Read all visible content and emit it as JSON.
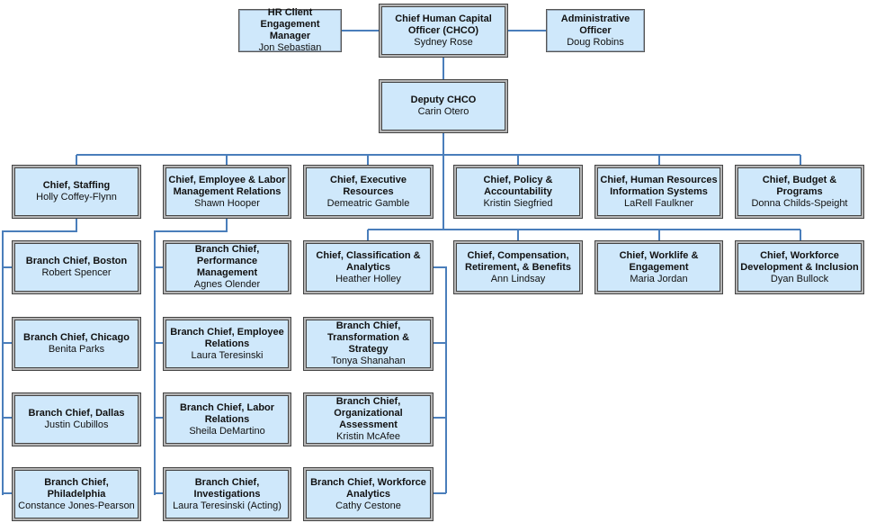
{
  "colors": {
    "box_fill": "#cfe8fb",
    "connector": "#4a7ebb",
    "border": "#444444"
  },
  "top": {
    "hr": {
      "title": "HR Client\nEngagement Manager",
      "name": "Jon Sebastian"
    },
    "chco": {
      "title": "Chief  Human Capital\nOfficer (CHCO)",
      "name": "Sydney Rose"
    },
    "admin": {
      "title": "Administrative\nOfficer",
      "name": "Doug Robins"
    },
    "deputy": {
      "title": "Deputy CHCO",
      "name": "Carin Otero"
    }
  },
  "chiefs": [
    {
      "title": "Chief, Staffing",
      "name": "Holly Coffey-Flynn"
    },
    {
      "title": "Chief, Employee & Labor\nManagement Relations",
      "name": "Shawn Hooper"
    },
    {
      "title": "Chief, Executive\nResources",
      "name": "Demeatric Gamble"
    },
    {
      "title": "Chief, Policy &\nAccountability",
      "name": "Kristin Siegfried"
    },
    {
      "title": "Chief, Human Resources\nInformation Systems",
      "name": "LaRell Faulkner"
    },
    {
      "title": "Chief, Budget & Programs",
      "name": "Donna Childs-Speight"
    }
  ],
  "chiefs2": [
    {
      "title": "Chief, Classification &\nAnalytics",
      "name": "Heather Holley"
    },
    {
      "title": "Chief, Compensation,\nRetirement, & Benefits",
      "name": "Ann Lindsay"
    },
    {
      "title": "Chief, Worklife &\nEngagement",
      "name": "Maria Jordan"
    },
    {
      "title": "Chief, Workforce\nDevelopment & Inclusion",
      "name": "Dyan Bullock"
    }
  ],
  "staffing_branches": [
    {
      "title": "Branch Chief, Boston",
      "name": "Robert Spencer"
    },
    {
      "title": "Branch Chief, Chicago",
      "name": "Benita Parks"
    },
    {
      "title": "Branch Chief, Dallas",
      "name": "Justin Cubillos"
    },
    {
      "title": "Branch Chief, Philadelphia",
      "name": "Constance Jones-Pearson"
    }
  ],
  "elmr_branches": [
    {
      "title": "Branch Chief,\nPerformance Management",
      "name": "Agnes Olender"
    },
    {
      "title": "Branch Chief, Employee\nRelations",
      "name": "Laura Teresinski"
    },
    {
      "title": "Branch Chief, Labor\nRelations",
      "name": "Sheila DeMartino"
    },
    {
      "title": "Branch Chief,\nInvestigations",
      "name": "Laura Teresinski (Acting)"
    }
  ],
  "class_branches": [
    {
      "title": "Branch Chief,\nTransformation & Strategy",
      "name": "Tonya Shanahan"
    },
    {
      "title": "Branch Chief,\nOrganizational\nAssessment",
      "name": "Kristin McAfee"
    },
    {
      "title": "Branch Chief, Workforce\nAnalytics",
      "name": "Cathy Cestone"
    }
  ]
}
